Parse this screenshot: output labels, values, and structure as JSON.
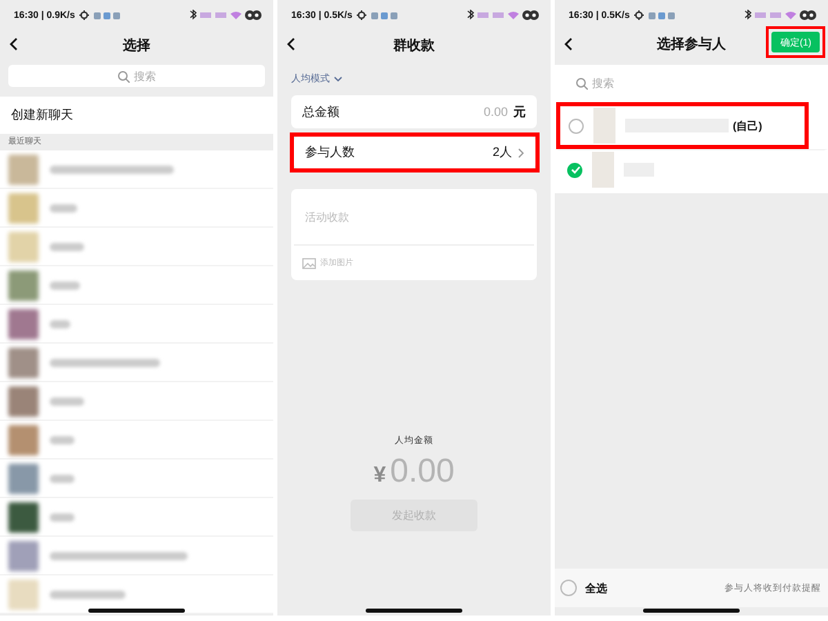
{
  "chat_select": {
    "status_bar": {
      "time": "16:30 | 0.9K/s"
    },
    "title": "选择",
    "search": {
      "placeholder": "搜索"
    },
    "new_chat": "创建新聊天",
    "section_label": "最近聊天",
    "recent_chats": [
      {
        "color": "#c9b89a"
      },
      {
        "color": "#d8c48c"
      },
      {
        "color": "#e2d3a8"
      },
      {
        "color": "#8c9a78"
      },
      {
        "color": "#a07890"
      },
      {
        "color": "#a09088"
      },
      {
        "color": "#9a8478"
      },
      {
        "color": "#b49070"
      },
      {
        "color": "#8898a8"
      },
      {
        "color": "#3c5a40"
      },
      {
        "color": "#a0a0b8"
      },
      {
        "color": "#e8dcc0"
      }
    ]
  },
  "group_collect": {
    "status_bar": {
      "time": "16:30 | 0.5K/s"
    },
    "title": "群收款",
    "mode": "人均模式",
    "total": {
      "label": "总金额",
      "value": "0.00",
      "unit": "元"
    },
    "participants": {
      "label": "参与人数",
      "value": "2人",
      "highlighted": true
    },
    "note": {
      "placeholder": "活动收款"
    },
    "add_image": "添加图片",
    "per_person": {
      "label": "人均金额",
      "currency": "¥",
      "amount": "0.00"
    },
    "submit": {
      "label": "发起收款",
      "disabled": true
    }
  },
  "select_participants": {
    "status_bar": {
      "time": "16:30 | 0.5K/s"
    },
    "title": "选择参与人",
    "confirm": {
      "label": "确定(1)",
      "highlighted": true
    },
    "search": {
      "placeholder": "搜索"
    },
    "people": [
      {
        "selected": false,
        "highlighted": true,
        "note": "(自己)"
      },
      {
        "selected": true,
        "highlighted": false
      }
    ],
    "select_all": {
      "label": "全选",
      "selected": false
    },
    "hint": "参与人将收到付款提醒"
  }
}
